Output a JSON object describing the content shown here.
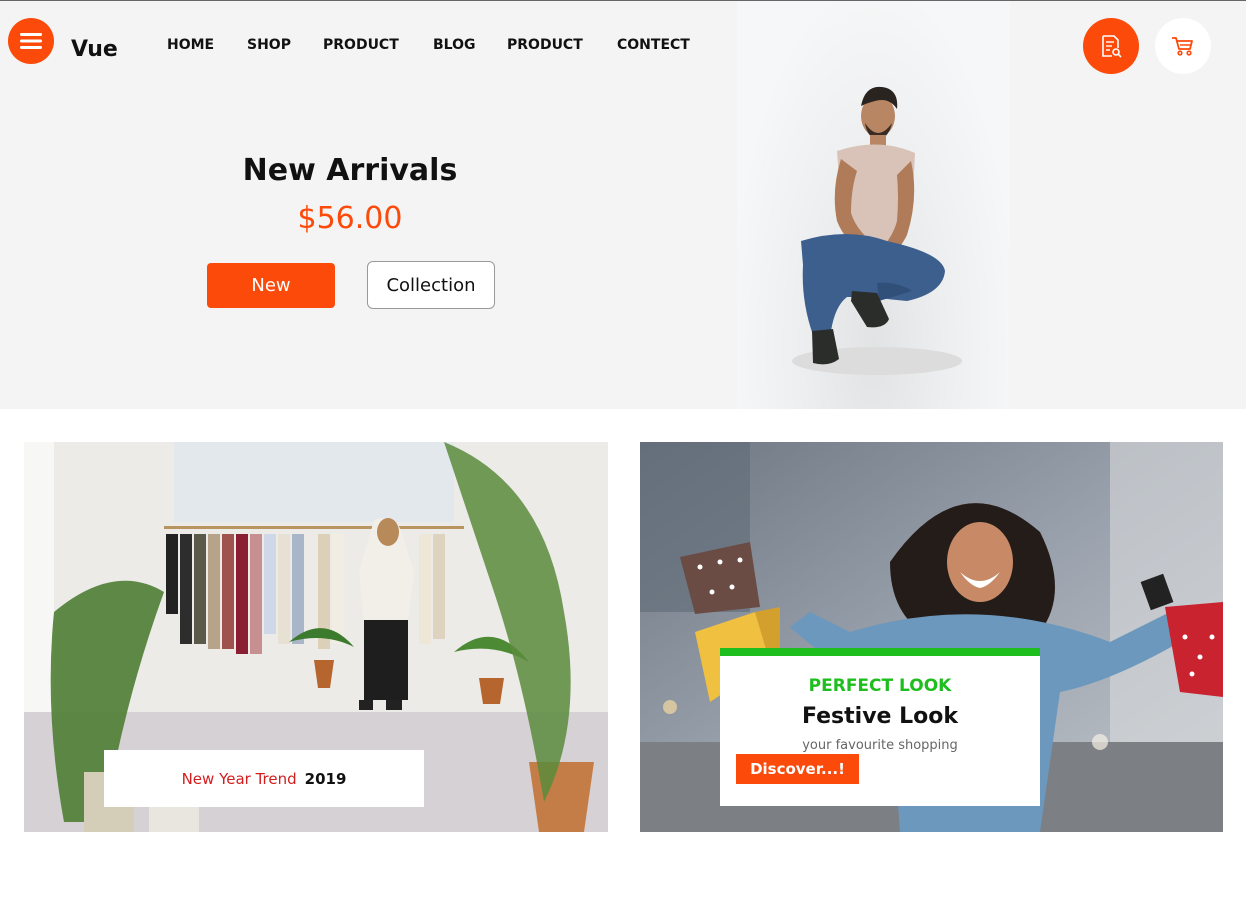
{
  "header": {
    "brand": "Vue",
    "nav": [
      "HOME",
      "SHOP",
      "PRODUCT",
      "BLOG",
      "PRODUCT",
      "CONTECT"
    ],
    "menu_icon": "hamburger-icon",
    "search_icon": "document-search-icon",
    "cart_icon": "cart-icon"
  },
  "hero": {
    "title": "New Arrivals",
    "price": "$56.00",
    "new_button": "New",
    "collection_button": "Collection"
  },
  "banners": {
    "left": {
      "label": "New Year Trend",
      "year": "2019"
    },
    "right": {
      "eyebrow": "PERFECT LOOK",
      "title": "Festive Look",
      "subtitle": "your favourite shopping",
      "button": "Discover...!"
    }
  },
  "colors": {
    "accent": "#fc4a0a",
    "green": "#1dbe1d",
    "red_text": "#d21e1e"
  }
}
